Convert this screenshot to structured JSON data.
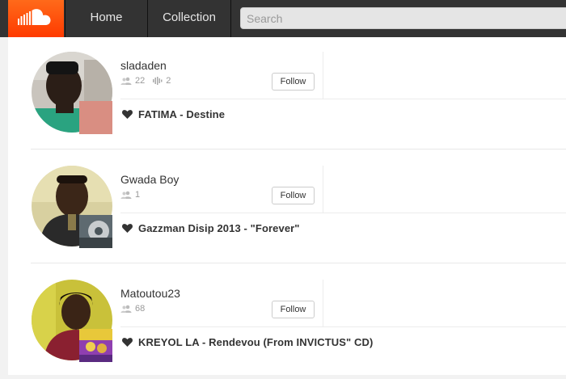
{
  "colors": {
    "brand": "#ff5500",
    "topbar": "#333333"
  },
  "header": {
    "logo_icon": "soundcloud-cloud-icon",
    "nav": [
      {
        "label": "Home"
      },
      {
        "label": "Collection"
      }
    ],
    "search_placeholder": "Search"
  },
  "cards": [
    {
      "username": "sladaden",
      "followers": "22",
      "tracks": "2",
      "follow_label": "Follow",
      "liked_track": "FATIMA - Destine"
    },
    {
      "username": "Gwada Boy",
      "followers": "1",
      "follow_label": "Follow",
      "liked_track": "Gazzman Disip 2013 - \"Forever\""
    },
    {
      "username": "Matoutou23",
      "followers": "68",
      "follow_label": "Follow",
      "liked_track": "KREYOL LA - Rendevou (From INVICTUS\" CD)"
    }
  ]
}
